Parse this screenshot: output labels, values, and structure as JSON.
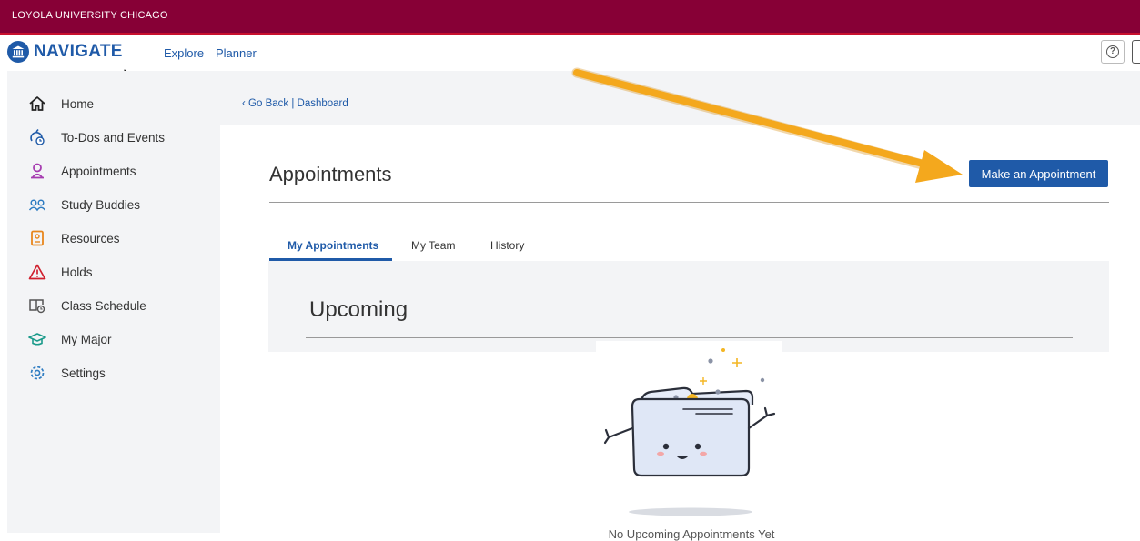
{
  "banner": {
    "text": "LOYOLA UNIVERSITY CHICAGO"
  },
  "topnav": {
    "logo_text": "NAVIGATE",
    "links": [
      {
        "label": "Explore"
      },
      {
        "label": "Planner"
      }
    ],
    "help_icon": "help-circle-icon",
    "help_glyph": "?"
  },
  "sidebar": {
    "items": [
      {
        "label": "Home",
        "icon": "home-icon"
      },
      {
        "label": "To-Dos and Events",
        "icon": "todo-icon"
      },
      {
        "label": "Appointments",
        "icon": "person-icon"
      },
      {
        "label": "Study Buddies",
        "icon": "people-icon"
      },
      {
        "label": "Resources",
        "icon": "resources-icon"
      },
      {
        "label": "Holds",
        "icon": "warning-icon"
      },
      {
        "label": "Class Schedule",
        "icon": "schedule-icon"
      },
      {
        "label": "My Major",
        "icon": "graduation-cap-icon"
      },
      {
        "label": "Settings",
        "icon": "gear-icon"
      }
    ]
  },
  "breadcrumb": {
    "text": "Go Back | Dashboard"
  },
  "page": {
    "title": "Appointments",
    "make_button": "Make an Appointment",
    "tabs": [
      {
        "label": "My Appointments",
        "active": true
      },
      {
        "label": "My Team",
        "active": false
      },
      {
        "label": "History",
        "active": false
      }
    ],
    "upcoming_title": "Upcoming",
    "empty_message": "No Upcoming Appointments Yet"
  },
  "colors": {
    "banner": "#870036",
    "brand_blue": "#1f5aa8",
    "sidebar_bg": "#f3f4f6",
    "annotation_arrow": "#f4a81d"
  }
}
